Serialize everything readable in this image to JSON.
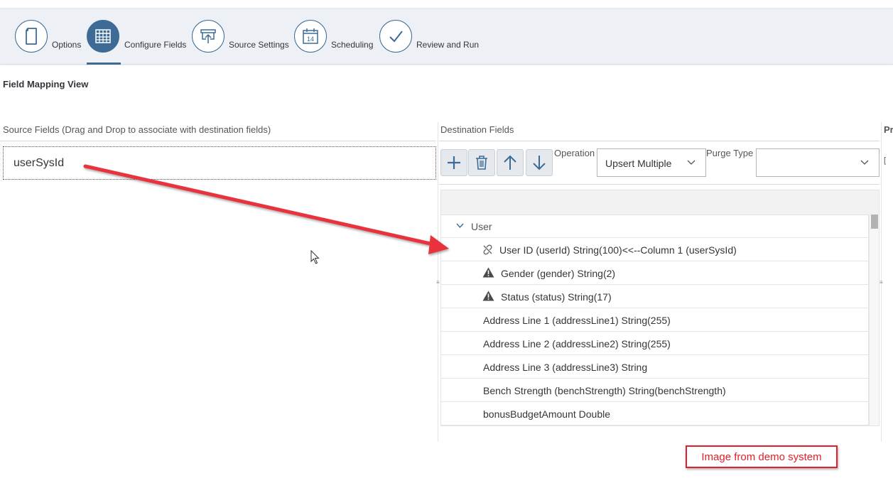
{
  "wizard": {
    "steps": [
      {
        "label": "Options",
        "icon": "document-icon"
      },
      {
        "label": "Configure Fields",
        "icon": "grid-icon",
        "active": true
      },
      {
        "label": "Source Settings",
        "icon": "upload-board-icon"
      },
      {
        "label": "Scheduling",
        "icon": "calendar-icon",
        "calendar_day": "14"
      },
      {
        "label": "Review and Run",
        "icon": "checkmark-icon"
      }
    ]
  },
  "page": {
    "title": "Field Mapping View"
  },
  "source": {
    "header": "Source Fields (Drag and Drop to associate with destination fields)",
    "fields": [
      "userSysId"
    ]
  },
  "destination": {
    "header": "Destination Fields",
    "next_panel_header": "Pr",
    "toolbar": {
      "buttons": [
        "add-icon",
        "trash-icon",
        "arrow-up-icon",
        "arrow-down-icon"
      ],
      "operation_label": "Operation",
      "operation_value": "Upsert Multiple",
      "purge_label": "Purge Type",
      "purge_value": ""
    },
    "tree": {
      "group": "User",
      "rows": [
        {
          "text": "User ID (userId) String(100)<<--Column 1 (userSysId)",
          "icon": "link-icon"
        },
        {
          "text": "Gender (gender) String(2)",
          "icon": "warning-icon"
        },
        {
          "text": "Status (status) String(17)",
          "icon": "warning-icon"
        },
        {
          "text": "Address Line 1 (addressLine1) String(255)",
          "icon": ""
        },
        {
          "text": "Address Line 2 (addressLine2) String(255)",
          "icon": ""
        },
        {
          "text": "Address Line 3 (addressLine3) String",
          "icon": ""
        },
        {
          "text": "Bench Strength (benchStrength) String(benchStrength)",
          "icon": ""
        },
        {
          "text": "bonusBudgetAmount Double",
          "icon": ""
        }
      ]
    }
  },
  "annotation": {
    "note": "Image from demo system",
    "color": "#e0202a"
  },
  "colors": {
    "accent": "#3d6b95",
    "wizard_bg": "#edf1f6"
  }
}
